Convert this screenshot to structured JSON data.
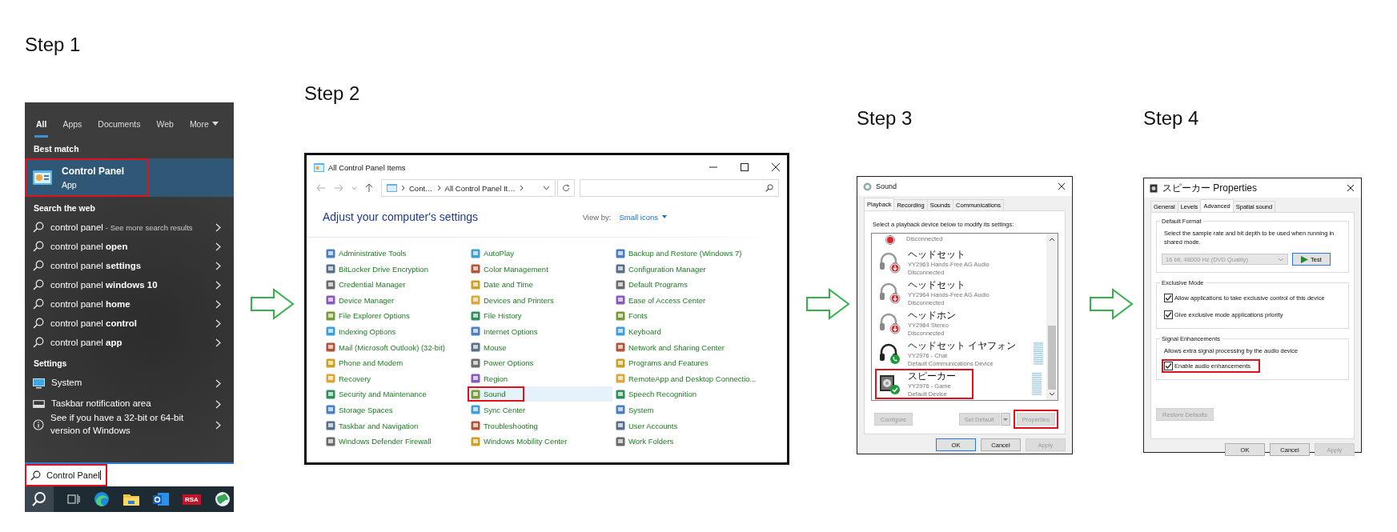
{
  "steps": [
    {
      "heading": "Step 1",
      "screen": {
        "kind": "search",
        "tabs": [
          {
            "label": "All",
            "selected": true
          },
          {
            "label": "Apps",
            "selected": false
          },
          {
            "label": "Documents",
            "selected": false
          },
          {
            "label": "Web",
            "selected": false
          },
          {
            "label": "More",
            "selected": false,
            "dropdown": true
          }
        ],
        "best_match": {
          "heading": "Best match",
          "title": "Control Panel",
          "subtitle": "App",
          "highlighted": true
        },
        "web": {
          "heading": "Search the web",
          "results": [
            {
              "text": "control panel",
              "note": "- See more search results"
            },
            {
              "text": "control panel **open**"
            },
            {
              "text": "control panel **settings**"
            },
            {
              "text": "control panel **windows 10**"
            },
            {
              "text": "control panel **home**"
            },
            {
              "text": "control panel **control**"
            },
            {
              "text": "control panel **app**"
            }
          ]
        },
        "settings": {
          "heading": "Settings",
          "items": [
            {
              "kind": "system",
              "text": "System"
            },
            {
              "kind": "taskbar",
              "text": "Taskbar notification area"
            },
            {
              "kind": "info",
              "text": "See if you have a 32-bit or 64-bit version of Windows"
            }
          ]
        },
        "search_box": {
          "value": "Control Panel",
          "highlighted": true
        },
        "taskbar": [
          {
            "kind": "search"
          },
          {
            "kind": "task_view"
          },
          {
            "kind": "browser"
          },
          {
            "kind": "folder"
          },
          {
            "kind": "mail"
          },
          {
            "kind": "label",
            "label": "RSA"
          },
          {
            "kind": "globe"
          }
        ]
      }
    },
    {
      "heading": "Step 2",
      "screen": {
        "kind": "control_panel",
        "title": "All Control Panel Items",
        "breadcrumb": [
          "Cont…",
          "All Control Panel It…"
        ],
        "heading": "Adjust your computer's settings",
        "view_by": {
          "label": "View by:",
          "value": "Small icons"
        },
        "columns": [
          {
            "items": [
              {
                "label": "Administrative Tools",
                "selected": false,
                "highlighted": false
              },
              {
                "label": "BitLocker Drive Encryption",
                "selected": false,
                "highlighted": false
              },
              {
                "label": "Credential Manager",
                "selected": false,
                "highlighted": false
              },
              {
                "label": "Device Manager",
                "selected": false,
                "highlighted": false
              },
              {
                "label": "File Explorer Options",
                "selected": false,
                "highlighted": false
              },
              {
                "label": "Indexing Options",
                "selected": false,
                "highlighted": false
              },
              {
                "label": "Mail (Microsoft Outlook) (32-bit)",
                "selected": false,
                "highlighted": false
              },
              {
                "label": "Phone and Modem",
                "selected": false,
                "highlighted": false
              },
              {
                "label": "Recovery",
                "selected": false,
                "highlighted": false
              },
              {
                "label": "Security and Maintenance",
                "selected": false,
                "highlighted": false
              },
              {
                "label": "Storage Spaces",
                "selected": false,
                "highlighted": false
              },
              {
                "label": "Taskbar and Navigation",
                "selected": false,
                "highlighted": false
              },
              {
                "label": "Windows Defender Firewall",
                "selected": false,
                "highlighted": false
              }
            ]
          },
          {
            "items": [
              {
                "label": "AutoPlay",
                "selected": false,
                "highlighted": false
              },
              {
                "label": "Color Management",
                "selected": false,
                "highlighted": false
              },
              {
                "label": "Date and Time",
                "selected": false,
                "highlighted": false
              },
              {
                "label": "Devices and Printers",
                "selected": false,
                "highlighted": false
              },
              {
                "label": "File History",
                "selected": false,
                "highlighted": false
              },
              {
                "label": "Internet Options",
                "selected": false,
                "highlighted": false
              },
              {
                "label": "Mouse",
                "selected": false,
                "highlighted": false
              },
              {
                "label": "Power Options",
                "selected": false,
                "highlighted": false
              },
              {
                "label": "Region",
                "selected": false,
                "highlighted": false
              },
              {
                "label": "Sound",
                "selected": true,
                "highlighted": true
              },
              {
                "label": "Sync Center",
                "selected": false,
                "highlighted": false
              },
              {
                "label": "Troubleshooting",
                "selected": false,
                "highlighted": false
              },
              {
                "label": "Windows Mobility Center",
                "selected": false,
                "highlighted": false
              }
            ]
          },
          {
            "items": [
              {
                "label": "Backup and Restore (Windows 7)",
                "selected": false,
                "highlighted": false
              },
              {
                "label": "Configuration Manager",
                "selected": false,
                "highlighted": false
              },
              {
                "label": "Default Programs",
                "selected": false,
                "highlighted": false
              },
              {
                "label": "Ease of Access Center",
                "selected": false,
                "highlighted": false
              },
              {
                "label": "Fonts",
                "selected": false,
                "highlighted": false
              },
              {
                "label": "Keyboard",
                "selected": false,
                "highlighted": false
              },
              {
                "label": "Network and Sharing Center",
                "selected": false,
                "highlighted": false
              },
              {
                "label": "Programs and Features",
                "selected": false,
                "highlighted": false
              },
              {
                "label": "RemoteApp and Desktop Connectio...",
                "selected": false,
                "highlighted": false
              },
              {
                "label": "Speech Recognition",
                "selected": false,
                "highlighted": false
              },
              {
                "label": "System",
                "selected": false,
                "highlighted": false
              },
              {
                "label": "User Accounts",
                "selected": false,
                "highlighted": false
              },
              {
                "label": "Work Folders",
                "selected": false,
                "highlighted": false
              }
            ]
          }
        ]
      }
    },
    {
      "heading": "Step 3",
      "screen": {
        "kind": "sound",
        "title": "Sound",
        "tabs": [
          {
            "label": "Playback",
            "selected": true
          },
          {
            "label": "Recording",
            "selected": false
          },
          {
            "label": "Sounds",
            "selected": false
          },
          {
            "label": "Communications",
            "selected": false
          }
        ],
        "instruction": "Select a playback device below to modify its settings:",
        "devices": [
          {
            "kind": "headphones",
            "status": "Disconnected",
            "badge": {
              "kind": "disconnected"
            },
            "meter": false,
            "highlighted": false
          },
          {
            "kind": "headphones",
            "name": "ヘッドセット",
            "model": "YY2963 Hands-Free AG Audio",
            "status": "Disconnected",
            "badge": {
              "kind": "disconnected"
            },
            "meter": false,
            "highlighted": false
          },
          {
            "kind": "headphones",
            "name": "ヘッドセット",
            "model": "YY2964 Hands-Free AG Audio",
            "status": "Disconnected",
            "badge": {
              "kind": "disconnected"
            },
            "meter": false,
            "highlighted": false
          },
          {
            "kind": "headphones",
            "name": "ヘッドホン",
            "model": "YY2964 Stereo",
            "status": "Disconnected",
            "badge": {
              "kind": "disconnected"
            },
            "meter": false,
            "highlighted": false
          },
          {
            "kind": "headset",
            "name": "ヘッドセット イヤフォン",
            "model": "YY2976 - Chat",
            "status": "Default Communications Device",
            "badge": {
              "kind": "communications"
            },
            "meter": true,
            "highlighted": false
          },
          {
            "kind": "speaker",
            "name": "スピーカー",
            "model": "YY2976 - Game",
            "status": "Default Device",
            "badge": {
              "kind": "default"
            },
            "meter": true,
            "highlighted": true
          }
        ],
        "buttons": [
          {
            "label": "Configure",
            "disabled": true,
            "split": false,
            "highlighted": false
          },
          {
            "label": "Set Default",
            "disabled": true,
            "split": true,
            "highlighted": false
          },
          {
            "label": "Properties",
            "disabled": true,
            "split": false,
            "highlighted": true
          }
        ],
        "footer_buttons": [
          {
            "label": "OK",
            "default": true,
            "disabled": false
          },
          {
            "label": "Cancel",
            "default": false,
            "disabled": false
          },
          {
            "label": "Apply",
            "default": false,
            "disabled": true
          }
        ]
      }
    },
    {
      "heading": "Step 4",
      "screen": {
        "kind": "properties",
        "title": "スピーカー Properties",
        "tabs": [
          {
            "label": "General",
            "selected": false
          },
          {
            "label": "Levels",
            "selected": false
          },
          {
            "label": "Advanced",
            "selected": true
          },
          {
            "label": "Spatial sound",
            "selected": false
          }
        ],
        "groups": [
          {
            "kind": "format",
            "title": "Default Format",
            "description": "Select the sample rate and bit depth to be used when running in shared mode.",
            "format": {
              "value": "16 bit, 48000 Hz (DVD Quality)",
              "disabled": true
            },
            "test_button": "Test"
          },
          {
            "kind": "checks",
            "title": "Exclusive Mode",
            "options": [
              {
                "label": "Allow applications to take exclusive control of this device",
                "checked": true,
                "highlighted": false
              },
              {
                "label": "Give exclusive mode applications priority",
                "checked": true,
                "highlighted": false
              }
            ]
          },
          {
            "kind": "checks",
            "title": "Signal Enhancements",
            "description": "Allows extra signal processing by the audio device",
            "options": [
              {
                "label": "Enable audio enhancements",
                "checked": true,
                "highlighted": true
              }
            ]
          }
        ],
        "restore_button": {
          "label": "Restore Defaults",
          "disabled": true
        },
        "footer_buttons": [
          {
            "label": "OK",
            "default": false,
            "disabled": false
          },
          {
            "label": "Cancel",
            "default": false,
            "disabled": false
          },
          {
            "label": "Apply",
            "default": false,
            "disabled": true
          }
        ]
      }
    }
  ]
}
